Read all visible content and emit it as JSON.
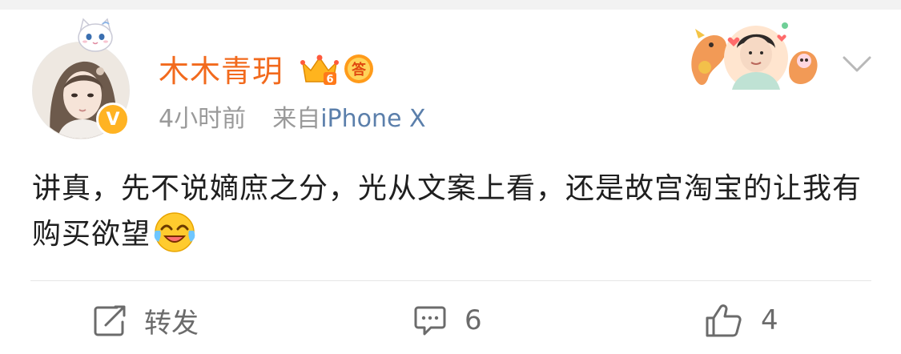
{
  "post": {
    "username": "木木青玥",
    "time": "4小时前",
    "source_prefix": "来自",
    "source": "iPhone X",
    "content": "讲真，先不说嫡庶之分，光从文案上看，还是故宫淘宝的让我有购买欲望",
    "content_emoji": "laugh-cry-emoji"
  },
  "badges": {
    "verified": "V",
    "crown_level": "6",
    "answer_badge": "答"
  },
  "actions": {
    "repost_label": "转发",
    "comment_count": "6",
    "like_count": "4"
  },
  "colors": {
    "username": "#f26a1d",
    "source_link": "#5b7fab",
    "meta_gray": "#9a9a9a",
    "verified_badge": "#ffb323"
  }
}
